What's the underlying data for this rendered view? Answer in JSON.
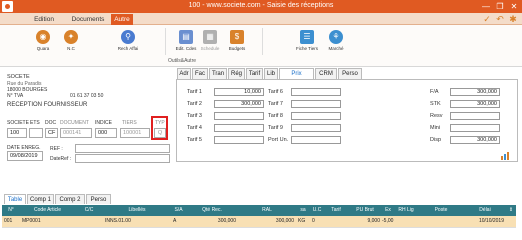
{
  "titlebar": {
    "title": "100 - www.societe.com - Saisie des réceptions",
    "minimize": "—",
    "maximize": "❐",
    "close": "✕",
    "color": "#e05a22"
  },
  "ribbon": {
    "tabs": [
      "Edition",
      "Documents",
      "Autre"
    ],
    "active_tab": "Autre",
    "right_icons": [
      "check-icon",
      "undo-icon",
      "settings-icon"
    ]
  },
  "toolbar": {
    "buttons": [
      {
        "name": "quara-button",
        "label": "Quara",
        "icon": "globe-icon",
        "color": "#d9822b"
      },
      {
        "name": "nc-button",
        "label": "N.C",
        "icon": "nc-icon",
        "color": "#d9822b"
      },
      {
        "name": "rech-affai-button",
        "label": "Rech Affai",
        "icon": "search-affair-icon",
        "color": "#4a7bd0"
      },
      {
        "name": "edit-cdes-button",
        "label": "Edit. Cdes",
        "icon": "document-icon",
        "color": "#6a8fd0"
      },
      {
        "name": "schedule-button",
        "label": "Schedule",
        "icon": "schedule-icon",
        "color": "#b0b0b0"
      },
      {
        "name": "budgets-button",
        "label": "Budgets",
        "icon": "budget-icon",
        "color": "#d9822b"
      },
      {
        "name": "fiche-tiers-button",
        "label": "Fiche Tiers",
        "icon": "contact-card-icon",
        "color": "#3c8fd0"
      },
      {
        "name": "marche-button",
        "label": "Marché",
        "icon": "market-icon",
        "color": "#3c8fd0"
      }
    ],
    "group_label": "Outils&Autre"
  },
  "left_panel": {
    "company": "SOCETE",
    "address1": "Rue du Paradis",
    "address2": "18000 BOURGES",
    "tva_label": "N° TVA",
    "phone": "01 61 37 03 50",
    "section_title": "RECEPTION FOURNISSEUR",
    "headers": {
      "societe": "SOCIETE",
      "ets": "ETS",
      "doc": "DOC",
      "document": "DOCUMENT",
      "indice": "INDICE",
      "tiers": "TIERS",
      "typ": "TYP"
    },
    "values": {
      "societe": "100",
      "ets": "",
      "doc": "CF",
      "document": "000141",
      "indice": "000",
      "tiers": "100001",
      "typ": "Q"
    },
    "date_label": "DATE ENREG.",
    "date_value": "09/08/2019",
    "ref_label": "REF :",
    "dateref_label": "DateRef :"
  },
  "right_tabs": [
    "Adr",
    "Fac",
    "Tran",
    "Rég",
    "Tarif",
    "Lib",
    "Prix",
    "CRM",
    "Perso"
  ],
  "right_active_tab": "Prix",
  "prices": {
    "col1": [
      {
        "label": "Tarif 1",
        "value": "10,000"
      },
      {
        "label": "Tarif 2",
        "value": "300,000"
      },
      {
        "label": "Tarif 3",
        "value": ""
      },
      {
        "label": "Tarif 4",
        "value": ""
      },
      {
        "label": "Tarif 5",
        "value": ""
      }
    ],
    "col2": [
      {
        "label": "Tarif 6",
        "value": ""
      },
      {
        "label": "Tarif 7",
        "value": ""
      },
      {
        "label": "Tarif 8",
        "value": ""
      },
      {
        "label": "Tarif 9",
        "value": ""
      },
      {
        "label": "Port Un.",
        "value": ""
      }
    ],
    "col3": [
      {
        "label": "F/A",
        "value": "300,000"
      },
      {
        "label": "STK",
        "value": "300,000"
      },
      {
        "label": "Resv",
        "value": ""
      },
      {
        "label": "Mini",
        "value": ""
      },
      {
        "label": "Disp",
        "value": "300,000"
      }
    ]
  },
  "bottom_tabs": [
    "Table",
    "Comp 1",
    "Comp 2",
    "Perso"
  ],
  "bottom_active_tab": "Table",
  "table": {
    "headers": [
      "N°",
      "Code Article",
      "C/C",
      "Libellés",
      "S/A",
      "Qté Rec.",
      "RAL",
      "sa",
      "U.C",
      "Tarif",
      "PU Brut",
      "Ex",
      "RH Lig",
      "Poste",
      "Délai"
    ],
    "rows": [
      [
        "001",
        "MP0001",
        "",
        "INNS.01.00",
        "A",
        "300,000",
        "300,000",
        "KG",
        "0",
        "",
        "9,000",
        "-5,00",
        "",
        "",
        "10/10/2019"
      ]
    ],
    "header_color": "#2f7a86",
    "row_color": "#f8e0b4"
  }
}
